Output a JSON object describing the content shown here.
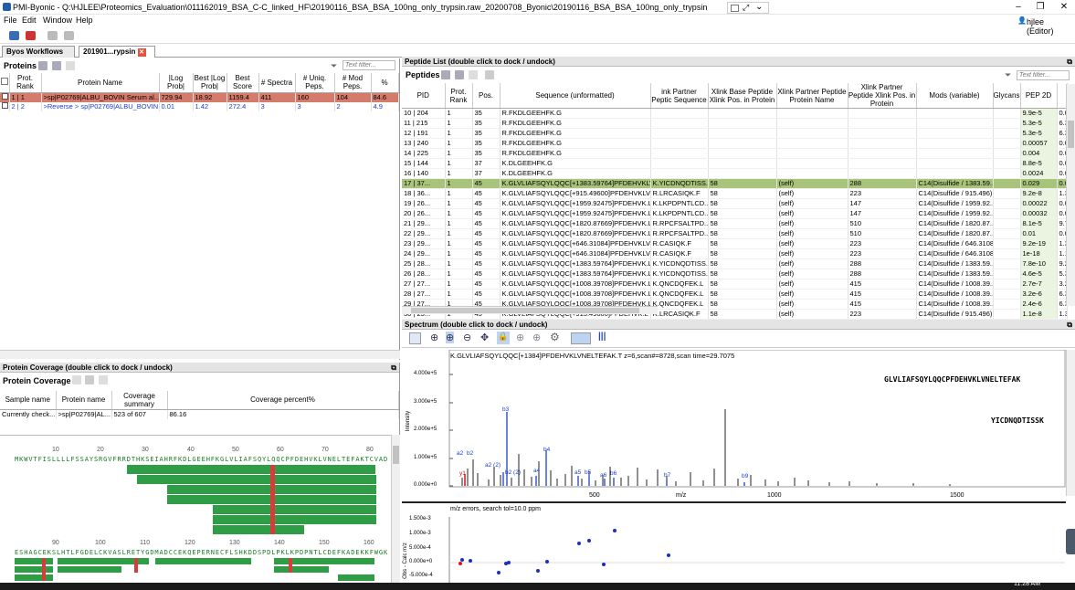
{
  "window": {
    "title": "PMI-Byonic - Q:\\HJLEE\\Proteomics_Evaluation\\011162019_BSA_C-C_linked_HF\\20190116_BSA_BSA_100ng_only_trypsin.raw_20200708_Byonic\\20190116_BSA_BSA_100ng_only_trypsin.raw_20200708_Byonic.byrslt - (v3.9-7 x64)",
    "user": "hjlee (Editor)"
  },
  "menu": [
    "File",
    "Edit",
    "Window",
    "Help"
  ],
  "tabs": [
    "Byos Workflows",
    "201901...rypsin"
  ],
  "proteins": {
    "title": "Proteins",
    "filter_placeholder": "Text filter...",
    "columns": [
      "Prot. Rank",
      "Protein Name",
      "|Log Prob|",
      "Best |Log Prob|",
      "Best Score",
      "# Spectra",
      "# Uniq. Peps.",
      "# Mod Peps.",
      "%"
    ],
    "rows": [
      [
        "1 | 1",
        ">sp|P02769|ALBU_BOVIN Serum al...",
        "729.94",
        "18.92",
        "1159.4",
        "411",
        "160",
        "104",
        "84.6"
      ],
      [
        "2 | 2",
        ">Reverse > sp|P02769|ALBU_BOVIN ...",
        "0.01",
        "1.42",
        "272.4",
        "3",
        "3",
        "2",
        "4.9"
      ]
    ]
  },
  "coverage": {
    "panel_title": "Protein Coverage (double click to dock / undock)",
    "title": "Protein Coverage",
    "columns": [
      "Sample name",
      "Protein name",
      "Coverage summary",
      "Coverage percent%"
    ],
    "row": [
      "Currently check...",
      ">sp|P02769|AL...",
      "523 of 607",
      "86.16"
    ],
    "ruler1": [
      "10",
      "20",
      "30",
      "40",
      "50",
      "60",
      "70",
      "80"
    ],
    "seq1": "MKWVTFISLLLLFSSAYSRGVFRRDTHKSEIAHRFKDLGEEHFKGLVLIAFSQYLQQCPFDEHVKLVNELTEFAKTCVAD",
    "ruler2": [
      "90",
      "100",
      "110",
      "120",
      "130",
      "140",
      "150",
      "160"
    ],
    "seq2": "ESHAGCEKSLHTLFGDELCKVASLRETYGDMADCCEKQEPERNECFLSHKDDSPDLPKLKPDPNTLCDEFKADEKKFWGK"
  },
  "peptides": {
    "panel_title": "Peptide List (double click to dock / undock)",
    "title": "Peptides",
    "filter_placeholder": "Text filter...",
    "columns": [
      "PID",
      "Prot. Rank",
      "Pos.",
      "Sequence (unformatted)",
      "ink Partner Peptic Sequence",
      "Xlink Base Peptide Xlink Pos. in Protein",
      "Xlink Partner Peptide Protein Name",
      "Xlink Partner Peptide Xlink Pos. in Protein",
      "Mods (variable)",
      "Glycans",
      "PEP 2D",
      ""
    ],
    "rows": [
      [
        "10 | 204",
        "1",
        "35",
        "R.FKDLGEEHFK.G",
        "",
        "",
        "",
        "",
        "",
        "",
        "9.9e-5",
        "0.0"
      ],
      [
        "11 | 215",
        "1",
        "35",
        "R.FKDLGEEHFK.G",
        "",
        "",
        "",
        "",
        "",
        "",
        "5.3e-5",
        "6.3"
      ],
      [
        "12 | 191",
        "1",
        "35",
        "R.FKDLGEEHFK.G",
        "",
        "",
        "",
        "",
        "",
        "",
        "5.3e-5",
        "6.3"
      ],
      [
        "13 | 240",
        "1",
        "35",
        "R.FKDLGEEHFK.G",
        "",
        "",
        "",
        "",
        "",
        "",
        "0.00057",
        "0.0"
      ],
      [
        "14 | 225",
        "1",
        "35",
        "R.FKDLGEEHFK.G",
        "",
        "",
        "",
        "",
        "",
        "",
        "0.004",
        "0.0"
      ],
      [
        "15 | 144",
        "1",
        "37",
        "K.DLGEEHFK.G",
        "",
        "",
        "",
        "",
        "",
        "",
        "8.8e-5",
        "0.0"
      ],
      [
        "16 | 140",
        "1",
        "37",
        "K.DLGEEHFK.G",
        "",
        "",
        "",
        "",
        "",
        "",
        "0.0024",
        "0.0"
      ],
      [
        "17 | 37...",
        "1",
        "45",
        "K.GLVLIAFSQYLQQC[+1383.59764]PFDEHVKLVNE...",
        "K.YICDNQDTISS...",
        "58",
        "(self)",
        "288",
        "C14(Disulfide / 1383.59...",
        "",
        "0.029",
        "0.0"
      ],
      [
        "18 | 36...",
        "1",
        "45",
        "K.GLVLIAFSQYLQQC[+915.49600]PFDEHVKLVNE...",
        "R.LRCASIQK.F",
        "58",
        "(self)",
        "223",
        "C14(Disulfide / 915.496)",
        "",
        "9.2e-8",
        "1.3"
      ],
      [
        "19 | 26...",
        "1",
        "45",
        "K.GLVLIAFSQYLQQC[+1959.92475]PFDEHVK.L",
        "K.LKPDPNTLCD...",
        "58",
        "(self)",
        "147",
        "C14(Disulfide / 1959.92...",
        "",
        "0.00022",
        "0.0"
      ],
      [
        "20 | 26...",
        "1",
        "45",
        "K.GLVLIAFSQYLQQC[+1959.92475]PFDEHVK.L",
        "K.LKPDPNTLCD...",
        "58",
        "(self)",
        "147",
        "C14(Disulfide / 1959.92...",
        "",
        "0.00032",
        "0.0"
      ],
      [
        "21 | 29...",
        "1",
        "45",
        "K.GLVLIAFSQYLQQC[+1820.87669]PFDEHVK.L",
        "R.RPCFSALTPD...",
        "58",
        "(self)",
        "510",
        "C14(Disulfide / 1820.87...",
        "",
        "8.1e-5",
        "9.7"
      ],
      [
        "22 | 29...",
        "1",
        "45",
        "K.GLVLIAFSQYLQQC[+1820.87669]PFDEHVK.L",
        "R.RPCFSALTPD...",
        "58",
        "(self)",
        "510",
        "C14(Disulfide / 1820.87...",
        "",
        "0.01",
        "0.0"
      ],
      [
        "23 | 29...",
        "1",
        "45",
        "K.GLVLIAFSQYLQQC[+646.31084]PFDEHVKLVNE...",
        "R.CASIQK.F",
        "58",
        "(self)",
        "223",
        "C14(Disulfide / 646.3108)",
        "",
        "9.2e-19",
        "1.3"
      ],
      [
        "24 | 29...",
        "1",
        "45",
        "K.GLVLIAFSQYLQQC[+646.31084]PFDEHVKLVNE...",
        "R.CASIQK.F",
        "58",
        "(self)",
        "223",
        "C14(Disulfide / 646.3108)",
        "",
        "1e-18",
        "1.1"
      ],
      [
        "25 | 28...",
        "1",
        "45",
        "K.GLVLIAFSQYLQQC[+1383.59764]PFDEHVK.L",
        "K.YICDNQDTISS...",
        "58",
        "(self)",
        "288",
        "C14(Disulfide / 1383.59...",
        "",
        "7.8e-10",
        "9.2"
      ],
      [
        "26 | 28...",
        "1",
        "45",
        "K.GLVLIAFSQYLQQC[+1383.59764]PFDEHVK.L",
        "K.YICDNQDTISS...",
        "58",
        "(self)",
        "288",
        "C14(Disulfide / 1383.59...",
        "",
        "4.6e-5",
        "5.3"
      ],
      [
        "27 | 27...",
        "1",
        "45",
        "K.GLVLIAFSQYLQQC[+1008.39708]PFDEHVK.L",
        "K.QNCDQFEK.L",
        "58",
        "(self)",
        "415",
        "C14(Disulfide / 1008.39...",
        "",
        "2.7e-7",
        "3.2"
      ],
      [
        "28 | 27...",
        "1",
        "45",
        "K.GLVLIAFSQYLQQC[+1008.39708]PFDEHVK.L",
        "K.QNCDQFEK.L",
        "58",
        "(self)",
        "415",
        "C14(Disulfide / 1008.39...",
        "",
        "3.2e-6",
        "6.3"
      ],
      [
        "29 | 27...",
        "1",
        "45",
        "K.GLVLIAFSQYLQQC[+1008.39708]PFDEHVK.L",
        "K.QNCDQFEK.L",
        "58",
        "(self)",
        "415",
        "C14(Disulfide / 1008.39...",
        "",
        "2.4e-6",
        "6.3"
      ],
      [
        "30 | 25...",
        "1",
        "45",
        "K.GLVLIAFSQYLQQC[+915.49600]PFDEHVK.L",
        "R.LRCASIQK.F",
        "58",
        "(self)",
        "223",
        "C14(Disulfide / 915.496)",
        "",
        "1.1e-8",
        "1.3"
      ]
    ]
  },
  "spectrum": {
    "panel_title": "Spectrum (double click to dock / undock)",
    "header": "K.GLVLIAFSQYLQQC[+1384]PFDEHVKLVNELTEFAK.T z=6,scan#=8728,scan time=29.7075",
    "ylabel": "Intensity",
    "xlabel": "m/z",
    "yticks": [
      "4.000e+5",
      "3.000e+5",
      "2.000e+5",
      "1.000e+5",
      "0.000e+0"
    ],
    "xticks": [
      "500",
      "1000",
      "1500"
    ],
    "peptide1": "GLVLIAFSQYLQQCPFDEHVKLVNELTEFAK",
    "peptide2": "YICDNQDTISSK",
    "labels": [
      "y1",
      "a2",
      "b2",
      "a2 (2)",
      "b3",
      "b2 (2)",
      "a4",
      "b4",
      "a5",
      "b5",
      "a6",
      "b6",
      "b7",
      "b9"
    ]
  },
  "errors": {
    "title": "m/z errors, search tol=10.0 ppm",
    "ylabel": "Obs - Calc m/z",
    "yticks": [
      "1.500e-3",
      "1.000e-3",
      "5.000e-4",
      "0.000e+0",
      "-5.000e-4"
    ]
  },
  "status": {
    "time": "11:28 AM"
  }
}
